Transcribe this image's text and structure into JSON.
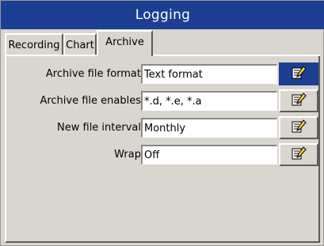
{
  "window": {
    "title": "Logging"
  },
  "tabs": [
    {
      "label": "Recording"
    },
    {
      "label": "Chart"
    },
    {
      "label": "Archive"
    }
  ],
  "settings": [
    {
      "label": "Archive file format",
      "value": "Text format",
      "edit_icon": "edit-icon"
    },
    {
      "label": "Archive file enables",
      "value": "*.d, *.e, *.a",
      "edit_icon": "edit-icon"
    },
    {
      "label": "New file interval",
      "value": "Monthly",
      "edit_icon": "edit-icon"
    },
    {
      "label": "Wrap",
      "value": "Off",
      "edit_icon": "edit-icon"
    }
  ],
  "colors": {
    "title_bar": "#1c3f93",
    "panel_background": "#d9d6d0",
    "focused_button": "#1c3f93"
  }
}
